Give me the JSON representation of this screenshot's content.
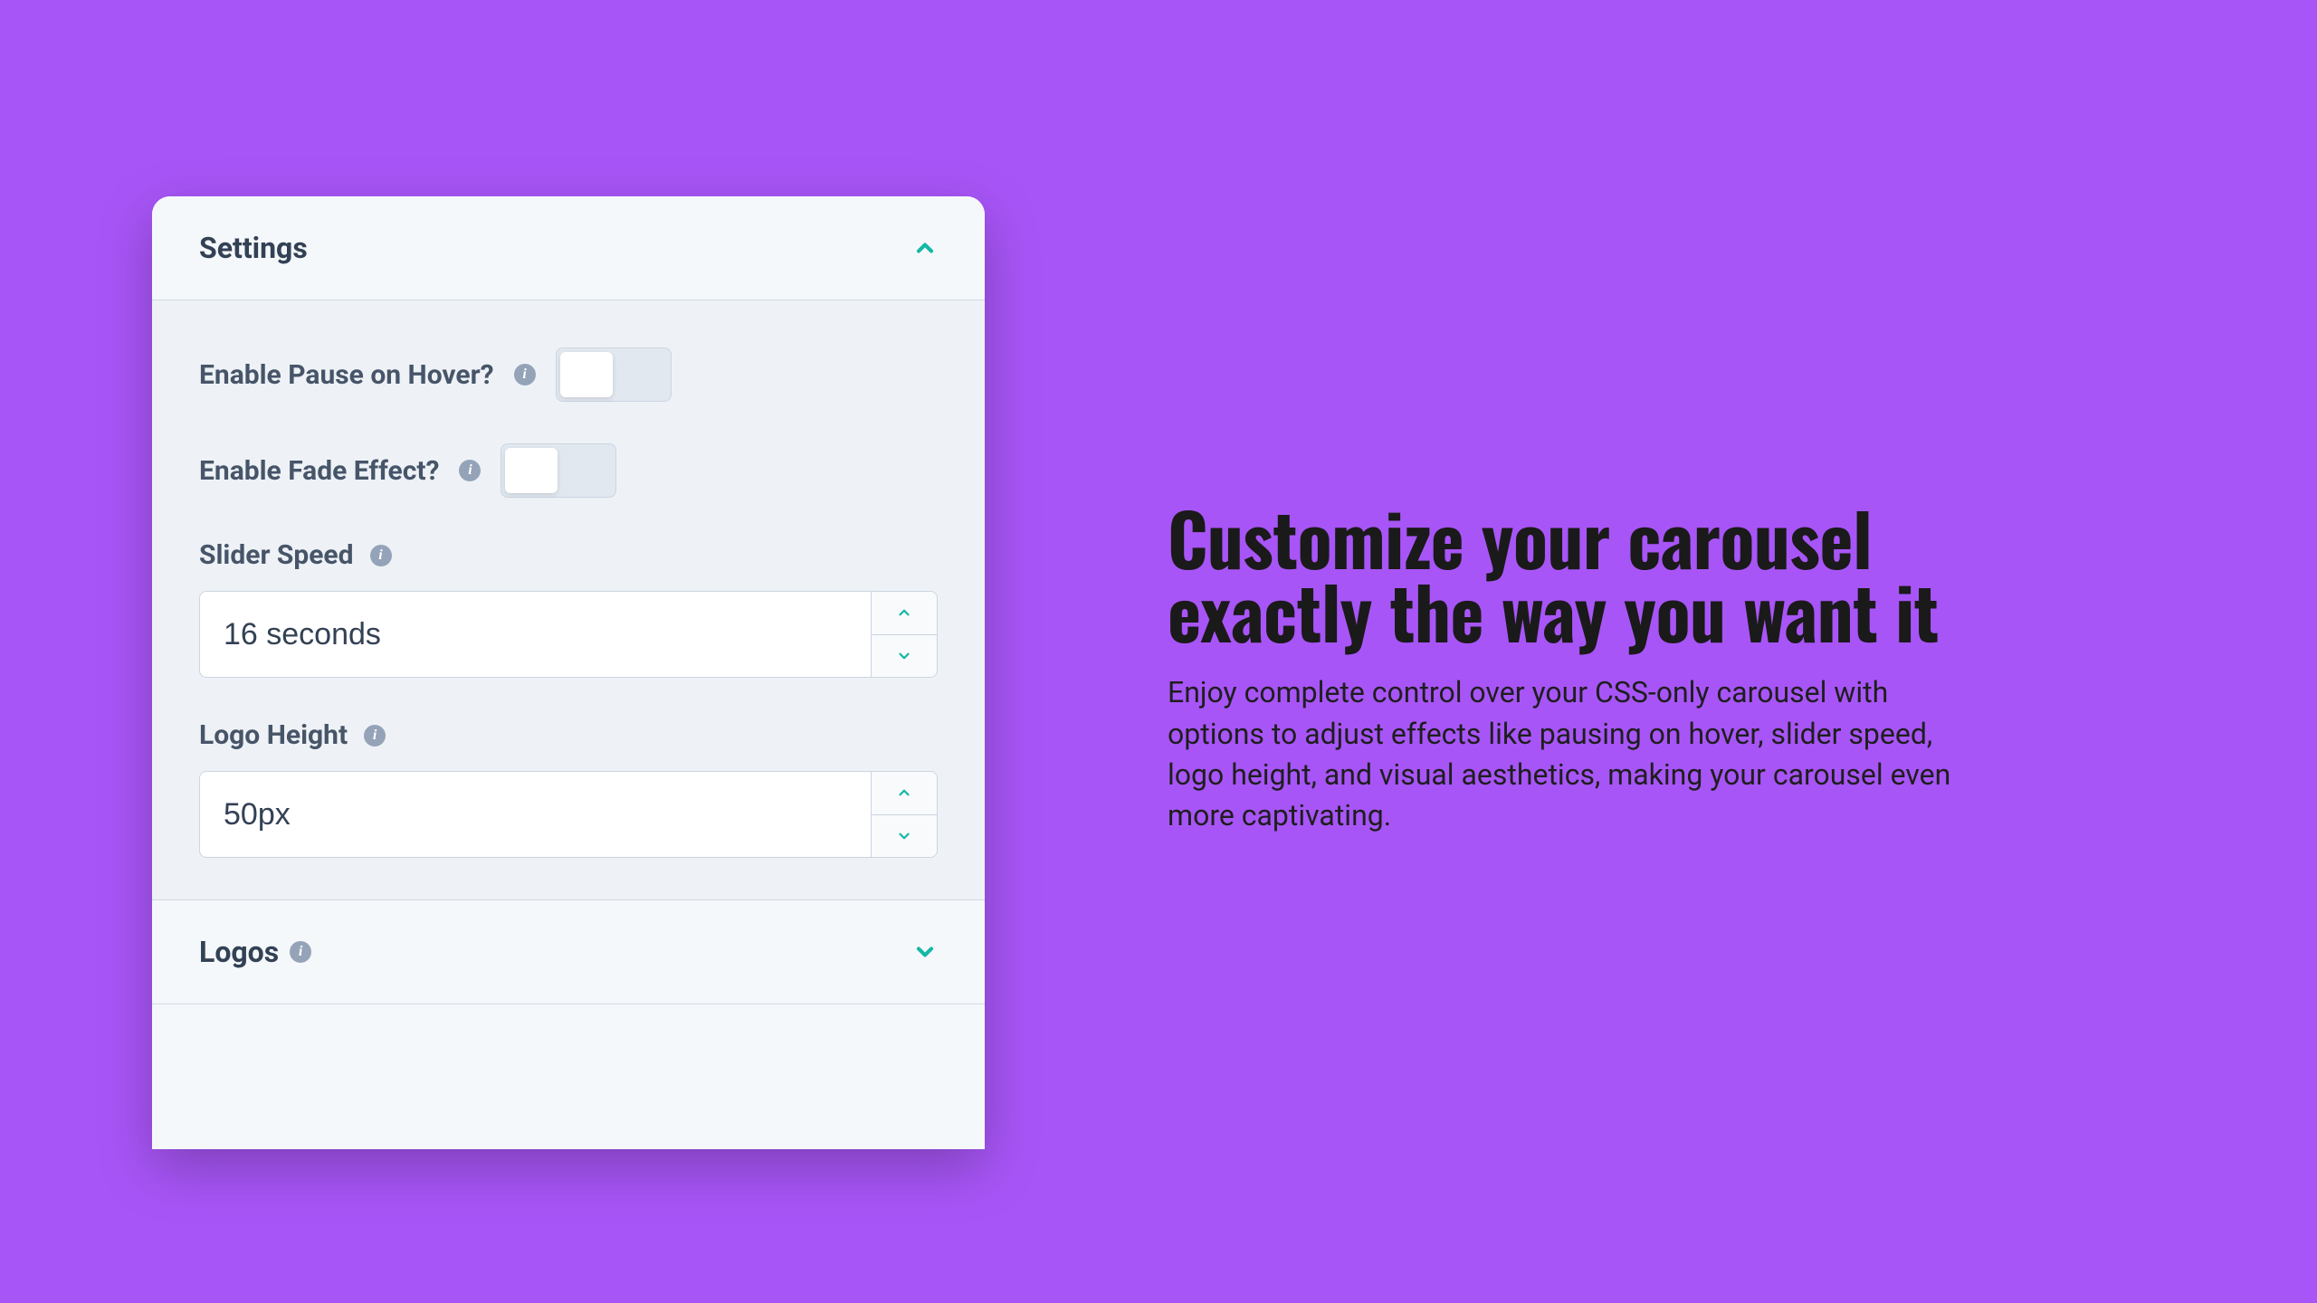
{
  "panel": {
    "settings_title": "Settings",
    "pause_hover_label": "Enable Pause on Hover?",
    "fade_effect_label": "Enable Fade Effect?",
    "slider_speed_label": "Slider Speed",
    "slider_speed_value": "16 seconds",
    "logo_height_label": "Logo Height",
    "logo_height_value": "50px",
    "logos_title": "Logos"
  },
  "marketing": {
    "heading": "Customize your carousel exactly the way you want it",
    "body": "Enjoy complete control over your CSS-only carousel with options to adjust effects like pausing on hover, slider speed, logo height, and visual aesthetics, making your carousel even more captivating."
  }
}
